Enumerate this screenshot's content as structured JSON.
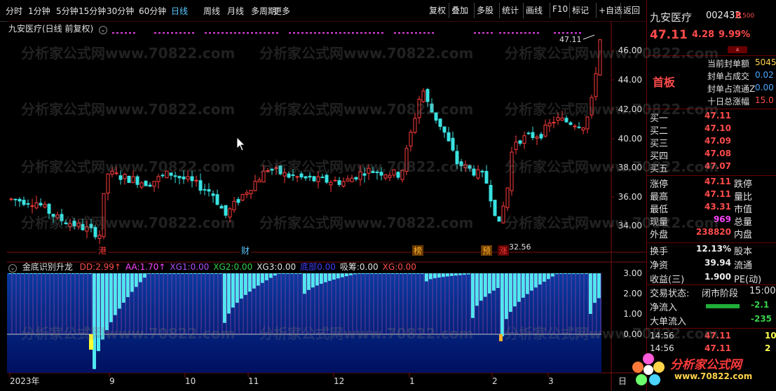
{
  "toolbar": {
    "periods": [
      "分时",
      "1分钟",
      "5分钟",
      "15分钟",
      "30分钟",
      "60分钟",
      "日线",
      "周线",
      "月线",
      "多周期",
      "更多"
    ],
    "active_period": "日线",
    "actions": [
      "复权",
      "叠加",
      "多股",
      "统计",
      "画线",
      "F10",
      "标记",
      "+自选",
      "返回"
    ]
  },
  "main_chart": {
    "title": "九安医疗(日线 前复权)",
    "price_labels": [
      "46.00",
      "44.00",
      "42.00",
      "40.00",
      "38.00",
      "36.00",
      "34.00"
    ],
    "high_marker": "47.11",
    "low_marker": "32.56",
    "event_tags": [
      "港",
      "财",
      "榜",
      "预",
      "涨"
    ]
  },
  "indicator": {
    "name": "金底识别升龙",
    "values": [
      {
        "label": "DD:",
        "value": "2.99",
        "suffix": "↑",
        "color": "#ff4b4b"
      },
      {
        "label": "AA:",
        "value": "1.70",
        "suffix": "↑",
        "color": "#ff45ff"
      },
      {
        "label": "XG1:",
        "value": "0.00",
        "suffix": "",
        "color": "#b050ff"
      },
      {
        "label": "XG2:",
        "value": "0.00",
        "suffix": "",
        "color": "#37d14b"
      },
      {
        "label": "XG3:",
        "value": "0.00",
        "suffix": "",
        "color": "#e0e0e0"
      },
      {
        "label": "底部",
        "value": "0.00",
        "suffix": "",
        "color": "#4040ff"
      },
      {
        "label": "吸筹:",
        "value": "0.00",
        "suffix": "",
        "color": "#e0e0e0"
      },
      {
        "label": "XG:",
        "value": "0.00",
        "suffix": "",
        "color": "#ff4b4b"
      }
    ],
    "scale_labels": [
      "3.00",
      "2.00",
      "1.00",
      "0.00"
    ]
  },
  "time_axis": {
    "labels": [
      "2023年",
      "9",
      "10",
      "11",
      "12",
      "1",
      "2",
      "3"
    ],
    "unit": "日"
  },
  "quote_panel": {
    "name": "九安医疗",
    "code": "002432",
    "tag": "R",
    "tag_num": "500",
    "price": "47.11",
    "change": "4.28",
    "pct": "9.99%",
    "board": "首板",
    "info_rows": [
      {
        "label": "当前封单额",
        "value": "5045"
      },
      {
        "label": "封单占成交",
        "value": "0.02"
      },
      {
        "label": "封单占流通Z",
        "value": "0.00"
      },
      {
        "label": "十日总涨幅",
        "value": "15.0"
      }
    ],
    "bids": [
      {
        "label": "买一",
        "price": "47.11",
        "vol": ""
      },
      {
        "label": "买二",
        "price": "47.10",
        "vol": ""
      },
      {
        "label": "买三",
        "price": "47.09",
        "vol": ""
      },
      {
        "label": "买四",
        "price": "47.08",
        "vol": ""
      },
      {
        "label": "买五",
        "price": "47.07",
        "vol": ""
      }
    ],
    "stats": [
      {
        "l1": "涨停",
        "v1": "47.11",
        "l2": "跌停",
        "v1color": "#ff4b4b"
      },
      {
        "l1": "最高",
        "v1": "47.11",
        "l2": "量比",
        "v1color": "#ff4b4b"
      },
      {
        "l1": "最低",
        "v1": "43.31",
        "l2": "市值",
        "v1color": "#ff4b4b"
      },
      {
        "l1": "现量",
        "v1": "969",
        "l2": "总量",
        "v1color": "#ff45ff"
      },
      {
        "l1": "外盘",
        "v1": "238820",
        "l2": "内盘",
        "v1color": "#ff4b4b"
      }
    ],
    "stats2": [
      {
        "l1": "换手",
        "v1": "12.13%",
        "l2": "股本"
      },
      {
        "l1": "净资",
        "v1": "39.94",
        "l2": "流通"
      },
      {
        "l1": "收益(三)",
        "v1": "1.900",
        "l2": "PE(动)"
      }
    ],
    "trade_state_label": "交易状态:",
    "trade_state": "闭市阶段",
    "trade_time": "15:00",
    "flows": [
      {
        "label": "净流入",
        "value": "-2.1"
      },
      {
        "label": "大单流入",
        "value": "-235"
      }
    ],
    "ticks": [
      {
        "time": "14:56",
        "price": "47.11",
        "vol": "10"
      },
      {
        "time": "14:56",
        "price": "47.11",
        "vol": "2"
      }
    ]
  },
  "watermark_text": "分析家公式网www.70822.com",
  "logo": {
    "title": "分析家公式网",
    "url": "www.70822.com"
  }
}
